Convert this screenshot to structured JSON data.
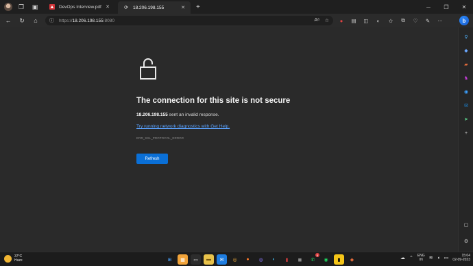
{
  "tabs": [
    {
      "title": "DevOps Interview.pdf",
      "active": false,
      "favicon": "pdf-icon"
    },
    {
      "title": "18.206.198.155",
      "active": true,
      "favicon": "page-icon"
    }
  ],
  "address_bar": {
    "scheme": "https://",
    "host": "18.206.198.155",
    "port": ":8080"
  },
  "error_page": {
    "title": "The connection for this site is not secure",
    "message_host": "18.206.198.155",
    "message_rest": " sent an invalid response.",
    "link_text": "Try running network diagnostics with Get Help.",
    "error_code": "ERR_SSL_PROTOCOL_ERROR",
    "button_label": "Refresh"
  },
  "weather": {
    "temp": "37°C",
    "condition": "Haze"
  },
  "tray": {
    "lang_line1": "ENG",
    "lang_line2": "IN",
    "time": "15:04",
    "date": "02-09-2023"
  },
  "taskbar_badge": "8",
  "colors": {
    "accent": "#0a6fd6",
    "link": "#5aa2ff",
    "background": "#2a2a2a"
  }
}
